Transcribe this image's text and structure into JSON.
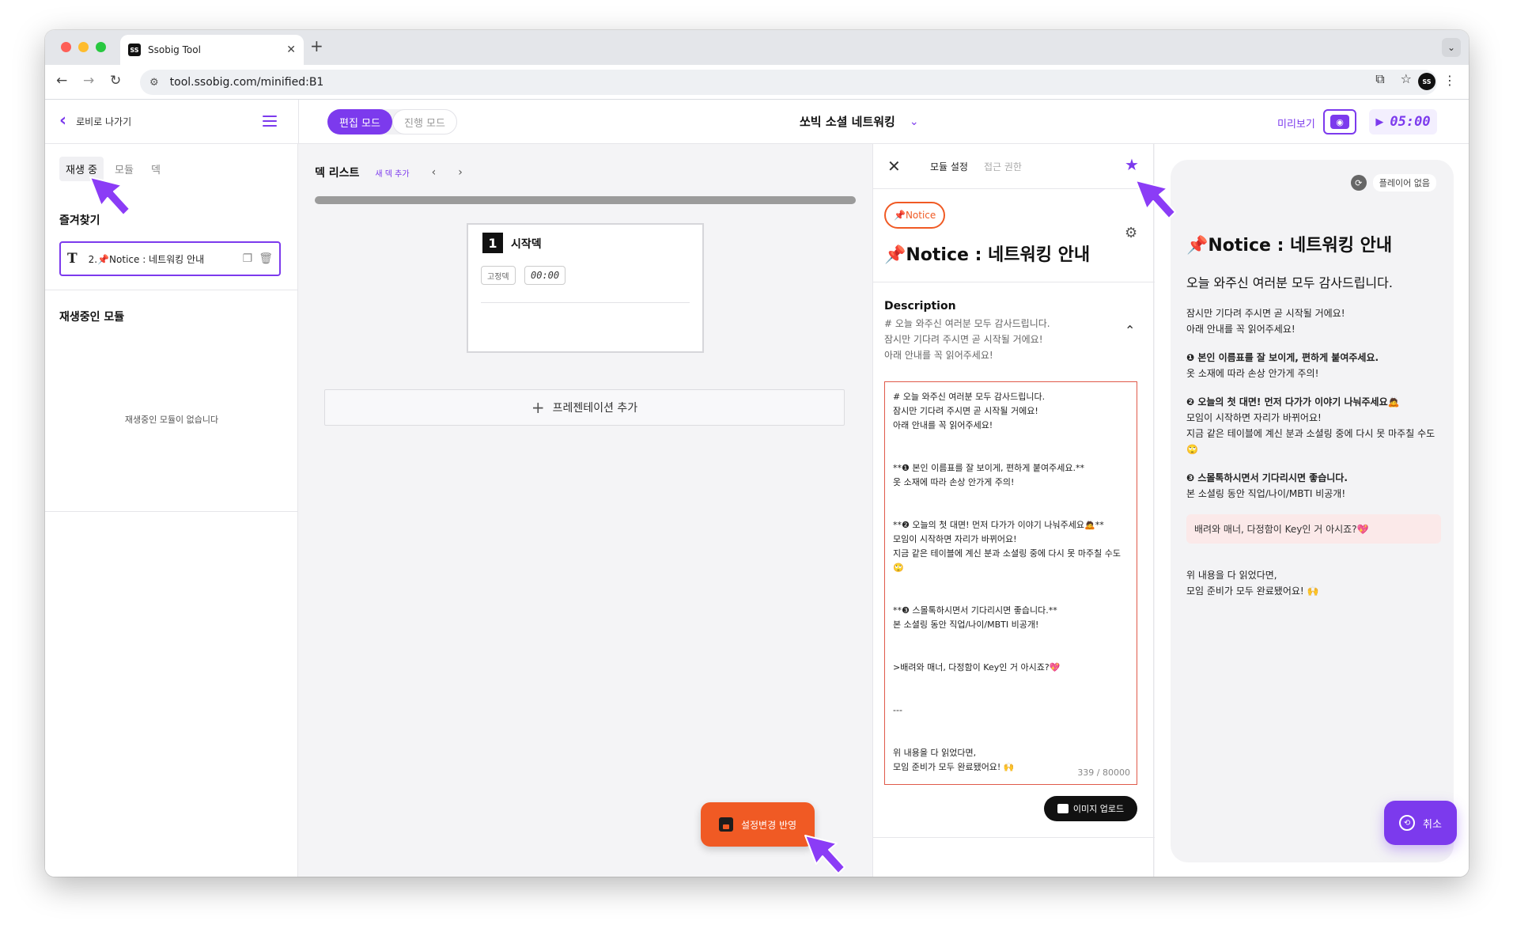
{
  "browser": {
    "tab_title": "Ssobig Tool",
    "url": "tool.ssobig.com/minified:B1"
  },
  "header": {
    "back_label": "로비로 나가기",
    "mode_edit": "편집 모드",
    "mode_run": "진행 모드",
    "project_title": "쏘빅 소셜 네트워킹",
    "preview_label": "미리보기",
    "timer": "05:00"
  },
  "left_panel": {
    "tabs": [
      "재생 중",
      "모듈",
      "덱"
    ],
    "favorites_title": "즐겨찾기",
    "favorite_item": "2.📌Notice : 네트워킹 안내",
    "playing_title": "재생중인 모듈",
    "empty_message": "재생중인 모듈이 없습니다"
  },
  "deck_list": {
    "title": "덱 리스트",
    "add_deck": "새 덱 추가",
    "card": {
      "number": "1",
      "title": "시작덱",
      "tag_fixed": "고정덱",
      "time": "00:00"
    },
    "add_presentation": "프레젠테이션 추가",
    "save_button": "설정변경 반영"
  },
  "settings": {
    "tab_module": "모듈 설정",
    "tab_access": "접근 권한",
    "chip": "📌Notice",
    "module_title": "📌Notice : 네트워킹 안내",
    "description_label": "Description",
    "description_preview": "# 오늘 와주신 여러분 모두 감사드립니다.\n잠시만 기다려 주시면 곧 시작될 거에요!\n아래 안내를 꼭 읽어주세요!",
    "editor_text": "# 오늘 와주신 여러분 모두 감사드립니다.\n잠시만 기다려 주시면 곧 시작될 거에요!\n아래 안내를 꼭 읽어주세요!\n\n\n**❶ 본인 이름표를 잘 보이게, 편하게 붙여주세요.**\n옷 소재에 따라 손상 안가게 주의!\n\n\n**❷ 오늘의 첫 대면! 먼저 다가가 이야기 나눠주세요🙇**\n 모임이 시작하면 자리가 바뀌어요!\n지금 같은 테이블에 계신 분과 소셜링 중에 다시 못 마주칠 수도🙄\n\n\n**❸ 스몰톡하시면서 기다리시면 좋습니다.**\n본 소셜링 동안 직업/나이/MBTI 비공개!\n\n\n>배려와 매너, 다정함이 Key인 거 아시죠?💖\n\n\n---\n\n\n위 내용을 다 읽었다면,\n모임 준비가 모두 완료됐어요! 🙌",
    "counter": "339 / 80000",
    "upload_button": "이미지 업로드"
  },
  "player": {
    "status": "플레이어 없음",
    "title": "📌Notice : 네트워킹 안내",
    "heading": "오늘 와주신 여러분 모두 감사드립니다.",
    "intro": "잠시만 기다려 주시면 곧 시작될 거에요!\n아래 안내를 꼭 읽어주세요!",
    "item1_bold": "❶ 본인 이름표를 잘 보이게, 편하게 붙여주세요.",
    "item1_text": "옷 소재에 따라 손상 안가게 주의!",
    "item2_bold": "❷ 오늘의 첫 대면! 먼저 다가가 이야기 나눠주세요🙇",
    "item2_text": "모임이 시작하면 자리가 바뀌어요!\n지금 같은 테이블에 계신 분과 소셜링 중에 다시 못 마주칠 수도🙄",
    "item3_bold": "❸ 스몰톡하시면서 기다리시면 좋습니다.",
    "item3_text": "본 소셜링 동안 직업/나이/MBTI 비공개!",
    "quote": "배려와 매너, 다정함이 Key인 거 아시죠?💖",
    "outro": "위 내용을 다 읽었다면,\n모임 준비가 모두 완료됐어요! 🙌",
    "cancel_button": "취소"
  },
  "colors": {
    "accent": "#7c3aed",
    "save": "#f05a24"
  }
}
